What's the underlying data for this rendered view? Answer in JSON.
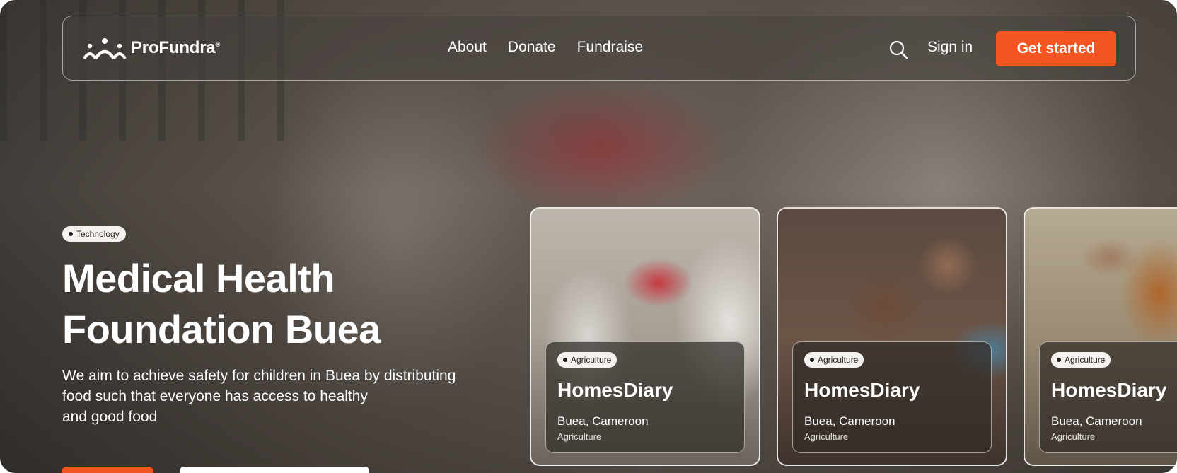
{
  "brand": {
    "name": "ProFundra",
    "mark": "®"
  },
  "nav": {
    "links": [
      "About",
      "Donate",
      "Fundraise"
    ],
    "sign_in": "Sign in",
    "cta": "Get started"
  },
  "hero": {
    "badge": "Technology",
    "title": "Medical Health Foundation Buea",
    "description": "We aim to achieve safety for children in Buea by distributing food such that everyone has access to healthy\nand good food"
  },
  "cards": [
    {
      "badge": "Agriculture",
      "title": "HomesDiary",
      "location": "Buea, Cameroon",
      "category": "Agriculture"
    },
    {
      "badge": "Agriculture",
      "title": "HomesDiary",
      "location": "Buea, Cameroon",
      "category": "Agriculture"
    },
    {
      "badge": "Agriculture",
      "title": "HomesDiary",
      "location": "Buea, Cameroon",
      "category": "Agriculture"
    }
  ],
  "colors": {
    "accent": "#f35420",
    "text_on_dark": "#ffffff",
    "badge_bg": "#f4f1ee"
  },
  "icons": {
    "search": "search-icon",
    "logo": "people-logo-icon"
  }
}
